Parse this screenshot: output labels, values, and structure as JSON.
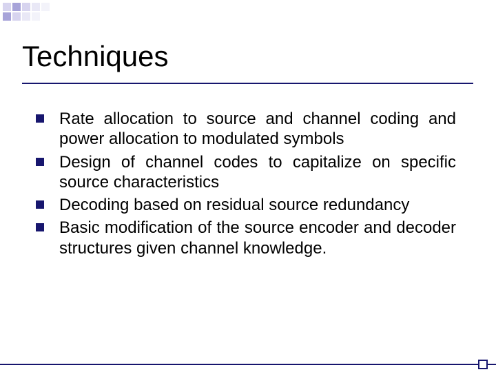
{
  "title": "Techniques",
  "bullets": [
    "Rate allocation to source and channel coding and power allocation to modulated symbols",
    "Design of channel codes to capitalize on specific source characteristics",
    "Decoding based on residual source redundancy",
    "Basic modification of the source encoder and decoder structures given channel knowledge."
  ],
  "decorColors": [
    "#d7d4ef",
    "#a7a3d9",
    "#d7d4ef",
    "#e9e8f6",
    "#f3f3fa",
    "#a7a3d9",
    "#d7d4ef",
    "#e9e8f6",
    "#f3f3fa",
    "#ffffff"
  ],
  "accentColor": "#17166e"
}
